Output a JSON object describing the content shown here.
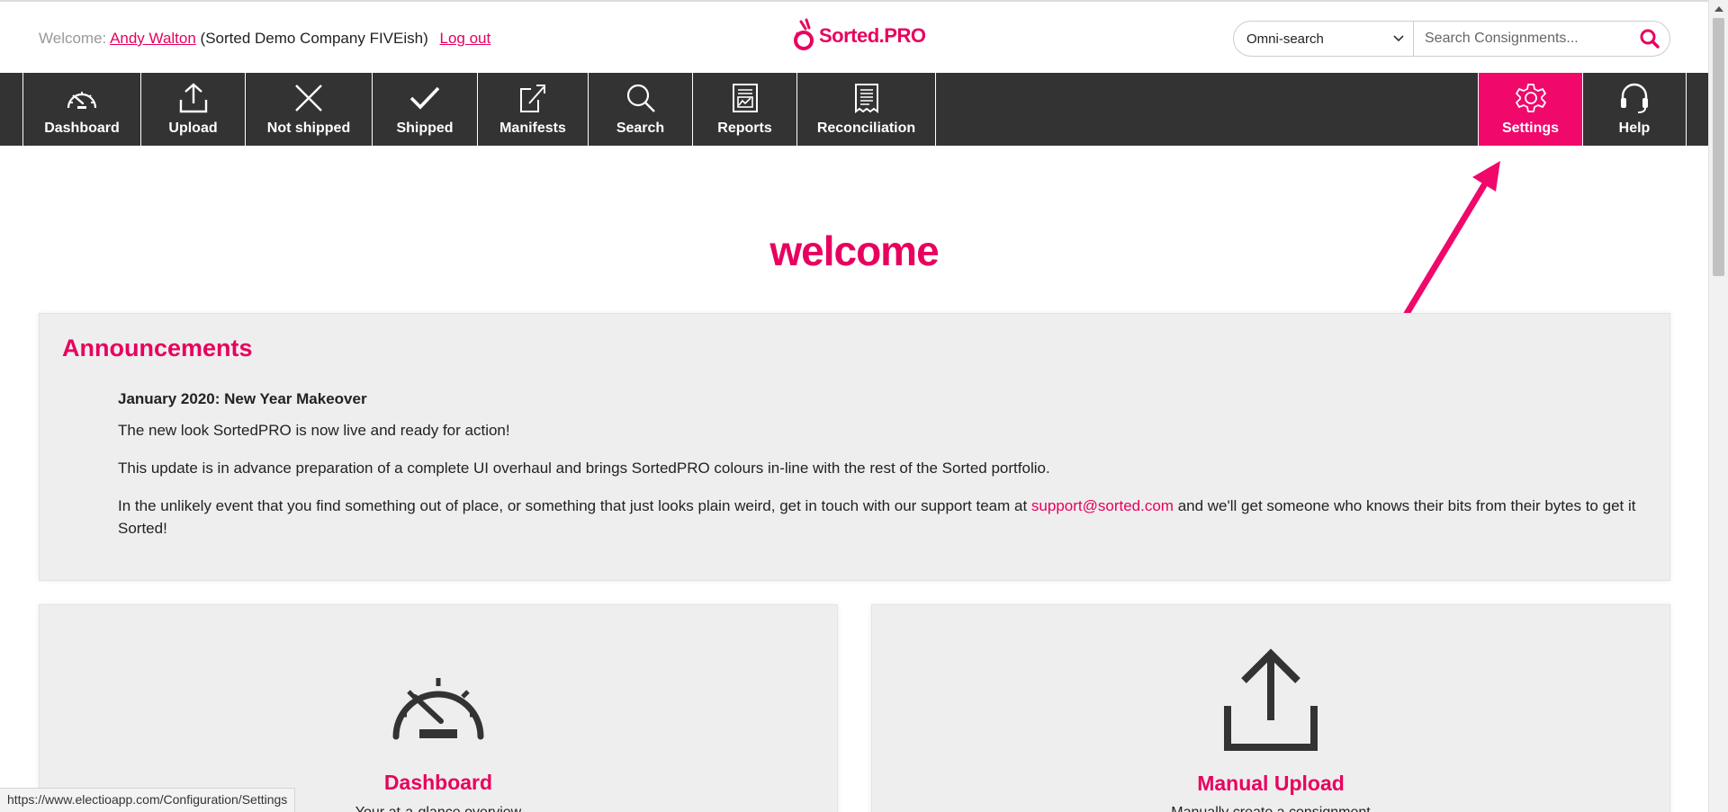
{
  "header": {
    "welcome_label": "Welcome:",
    "user_name": "Andy Walton",
    "company": "(Sorted Demo Company FIVEish)",
    "logout_label": "Log out",
    "logo_text": "Sorted.PRO",
    "omni_select_value": "Omni-search",
    "search_placeholder": "Search Consignments..."
  },
  "nav": {
    "items": [
      {
        "label": "Dashboard",
        "icon": "speedometer-icon"
      },
      {
        "label": "Upload",
        "icon": "upload-icon"
      },
      {
        "label": "Not shipped",
        "icon": "x-icon"
      },
      {
        "label": "Shipped",
        "icon": "check-icon"
      },
      {
        "label": "Manifests",
        "icon": "export-document-icon"
      },
      {
        "label": "Search",
        "icon": "magnifier-icon"
      },
      {
        "label": "Reports",
        "icon": "report-icon"
      },
      {
        "label": "Reconciliation",
        "icon": "receipt-icon"
      },
      {
        "label": "Settings",
        "icon": "gear-icon",
        "active": true
      },
      {
        "label": "Help",
        "icon": "headset-icon"
      }
    ]
  },
  "main": {
    "title": "welcome"
  },
  "announcements": {
    "heading": "Announcements",
    "item_title": "January 2020: New Year Makeover",
    "para1": "The new look SortedPRO is now live and ready for action!",
    "para2": "This update is in advance preparation of a complete UI overhaul and brings SortedPRO colours in-line with the rest of the Sorted portfolio.",
    "para3_before": "In the unlikely event that you find something out of place, or something that just looks plain weird, get in touch with our support team at ",
    "para3_link": "support@sorted.com",
    "para3_after": " and we'll get someone who knows their bits from their bytes to get it Sorted!"
  },
  "tiles": [
    {
      "title": "Dashboard",
      "subtitle": "Your at-a-glance overview",
      "icon": "speedometer-icon"
    },
    {
      "title": "Manual Upload",
      "subtitle": "Manually create a consignment",
      "icon": "upload-icon"
    }
  ],
  "statusbar": {
    "url": "https://www.electioapp.com/Configuration/Settings"
  },
  "colors": {
    "brand": "#e8005e",
    "nav_bg": "#333333",
    "active_nav": "#f0086b"
  }
}
